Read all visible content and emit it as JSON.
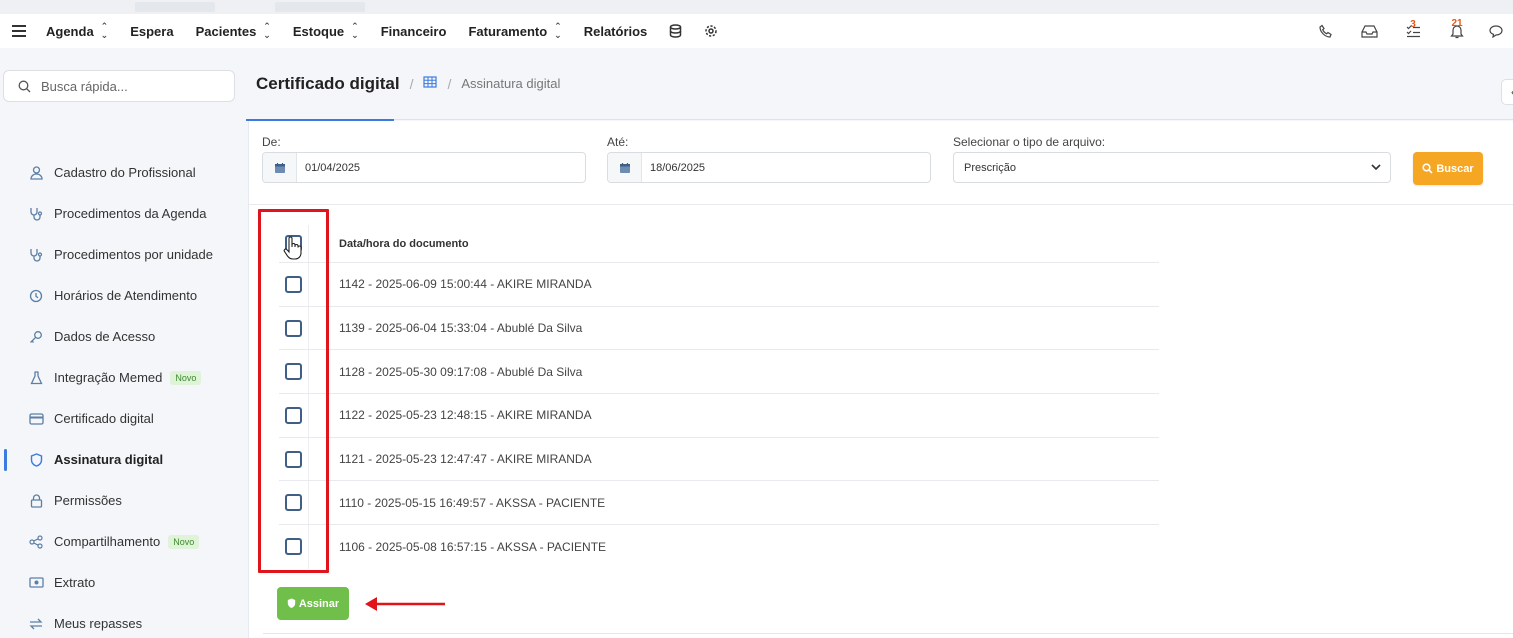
{
  "navbar": {
    "items": [
      {
        "label": "Agenda",
        "dropdown": true
      },
      {
        "label": "Espera",
        "dropdown": false
      },
      {
        "label": "Pacientes",
        "dropdown": true
      },
      {
        "label": "Estoque",
        "dropdown": true
      },
      {
        "label": "Financeiro",
        "dropdown": false
      },
      {
        "label": "Faturamento",
        "dropdown": true
      },
      {
        "label": "Relatórios",
        "dropdown": false
      }
    ],
    "badges": {
      "tasks": "3",
      "notifications": "21"
    }
  },
  "sidebar": {
    "search_placeholder": "Busca rápida...",
    "items": [
      {
        "label": "Cadastro do Profissional",
        "icon": "user-icon"
      },
      {
        "label": "Procedimentos da Agenda",
        "icon": "stethoscope-icon"
      },
      {
        "label": "Procedimentos por unidade",
        "icon": "stethoscope-icon"
      },
      {
        "label": "Horários de Atendimento",
        "icon": "clock-icon"
      },
      {
        "label": "Dados de Acesso",
        "icon": "key-icon"
      },
      {
        "label": "Integração Memed",
        "icon": "flask-icon",
        "tag": "Novo"
      },
      {
        "label": "Certificado digital",
        "icon": "card-icon"
      },
      {
        "label": "Assinatura digital",
        "icon": "shield-icon",
        "active": true
      },
      {
        "label": "Permissões",
        "icon": "lock-icon"
      },
      {
        "label": "Compartilhamento",
        "icon": "share-icon",
        "tag": "Novo"
      },
      {
        "label": "Extrato",
        "icon": "money-icon"
      },
      {
        "label": "Meus repasses",
        "icon": "transfer-icon"
      }
    ]
  },
  "breadcrumb": {
    "title": "Certificado digital",
    "crumb": "Assinatura digital"
  },
  "filters": {
    "from_label": "De:",
    "from_value": "01/04/2025",
    "to_label": "Até:",
    "to_value": "18/06/2025",
    "type_label": "Selecionar o tipo de arquivo:",
    "type_value": "Prescrição",
    "search_button": "Buscar"
  },
  "table": {
    "header": "Data/hora do documento",
    "rows": [
      "1142 - 2025-06-09 15:00:44 - AKIRE MIRANDA",
      "1139 - 2025-06-04 15:33:04 - Abublé Da Silva",
      "1128 - 2025-05-30 09:17:08 - Abublé Da Silva",
      "1122 - 2025-05-23 12:48:15 - AKIRE MIRANDA",
      "1121 - 2025-05-23 12:47:47 - AKIRE MIRANDA",
      "1110 - 2025-05-15 16:49:57 - AKSSA - PACIENTE",
      "1106 - 2025-05-08 16:57:15 - AKSSA - PACIENTE"
    ]
  },
  "sign_button": "Assinar",
  "colors": {
    "accent": "#3b7be0",
    "search_btn": "#f5a623",
    "sign_btn": "#6fbf4a",
    "highlight": "#e0151c"
  }
}
